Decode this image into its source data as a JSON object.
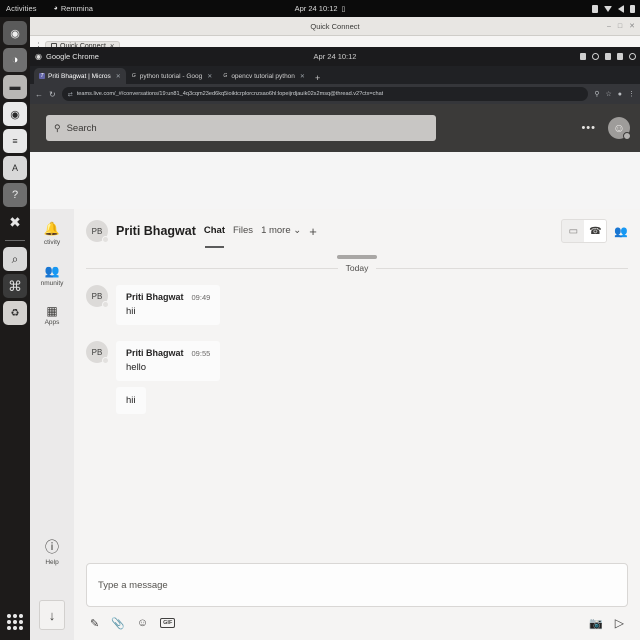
{
  "gnome": {
    "activities": "Activities",
    "app_name": "Remmina",
    "clock": "Apr 24  10:12",
    "tray_icons": [
      "recording-icon",
      "network-icon",
      "volume-icon",
      "battery-icon"
    ]
  },
  "dock": {
    "items": [
      {
        "name": "firefox",
        "glyph": "●"
      },
      {
        "name": "thunderbird",
        "glyph": "◐"
      },
      {
        "name": "files",
        "glyph": "▬"
      },
      {
        "name": "rhythmbox",
        "glyph": "◉"
      },
      {
        "name": "libreoffice-writer",
        "glyph": "≡"
      },
      {
        "name": "libreoffice-draw",
        "glyph": "A"
      },
      {
        "name": "help",
        "glyph": "?"
      },
      {
        "name": "vscode",
        "glyph": "✕"
      },
      {
        "name": "magnifier",
        "glyph": "⌕"
      },
      {
        "name": "blocked",
        "glyph": "⊘"
      },
      {
        "name": "trash",
        "glyph": "♻"
      }
    ]
  },
  "remmina": {
    "window_title": "Quick Connect",
    "tab_label": "Quick Connect",
    "window_buttons": [
      "–",
      "□",
      "✕"
    ]
  },
  "chrome": {
    "title": "Google Chrome",
    "title_center": "Apr 24  10:12",
    "window_buttons": [
      "–",
      "□",
      "✕"
    ],
    "tabs": [
      {
        "title": "Priti Bhagwat | Micros",
        "favicon": "teams-icon",
        "active": true
      },
      {
        "title": "python tutorial - Goog",
        "favicon": "google-icon",
        "active": false
      },
      {
        "title": "opencv tutorial python",
        "favicon": "google-icon",
        "active": false
      }
    ],
    "new_tab_label": "+",
    "nav": {
      "back": "←",
      "reload": "↻"
    },
    "url": "teams.live.com/_#/conversations/19:un81_4q3cqm23ed6kq5ioiktcrplorcnzsao6hl:lopeijrdjauik02s2msq@thread.v2?ctx=chat",
    "url_lock": "⇄",
    "omni_icons": [
      "search-share-icon",
      "bookmark-star-icon",
      "profile-icon",
      "chrome-menu-icon"
    ]
  },
  "teams": {
    "search": {
      "placeholder": "Search",
      "icon": "search-icon"
    },
    "topbar": {
      "more_label": "•••",
      "avatar_initials": ""
    },
    "rail": [
      {
        "name": "activity",
        "label": "ctivity",
        "icon": "bell-icon"
      },
      {
        "name": "community",
        "label": "nmunity",
        "icon": "people-icon"
      },
      {
        "name": "apps",
        "label": "Apps",
        "icon": "grid-icon"
      }
    ],
    "rail_help": {
      "label": "Help",
      "icon": "help-icon"
    },
    "rail_download": {
      "icon": "download-icon"
    },
    "chat_header": {
      "avatar_initials": "PB",
      "name": "Priti Bhagwat",
      "tabs": [
        {
          "label": "Chat",
          "active": true
        },
        {
          "label": "Files",
          "active": false
        },
        {
          "label": "1 more",
          "active": false,
          "caret": "⌄"
        }
      ],
      "add_tab": "+",
      "actions": [
        "video-call-icon",
        "audio-call-icon",
        "add-people-icon"
      ]
    },
    "day_divider": "Today",
    "message_groups": [
      {
        "avatar_initials": "PB",
        "author": "Priti Bhagwat",
        "time": "09:49",
        "messages": [
          "hii"
        ]
      },
      {
        "avatar_initials": "PB",
        "author": "Priti Bhagwat",
        "time": "09:55",
        "messages": [
          "hello",
          "hii"
        ]
      }
    ],
    "compose": {
      "placeholder": "Type a message",
      "tools": [
        "format-icon",
        "attach-icon",
        "emoji-icon",
        "gif-icon"
      ],
      "gif_label": "GIF",
      "right_tools": [
        "video-clip-icon",
        "send-icon"
      ]
    }
  },
  "colors": {
    "teams_topbar": "#3b3a39",
    "teams_rail": "#ebeaea",
    "teams_main": "#f5f4f3",
    "chrome_dark": "#202124",
    "gnome_bar": "#0b0b0b"
  }
}
